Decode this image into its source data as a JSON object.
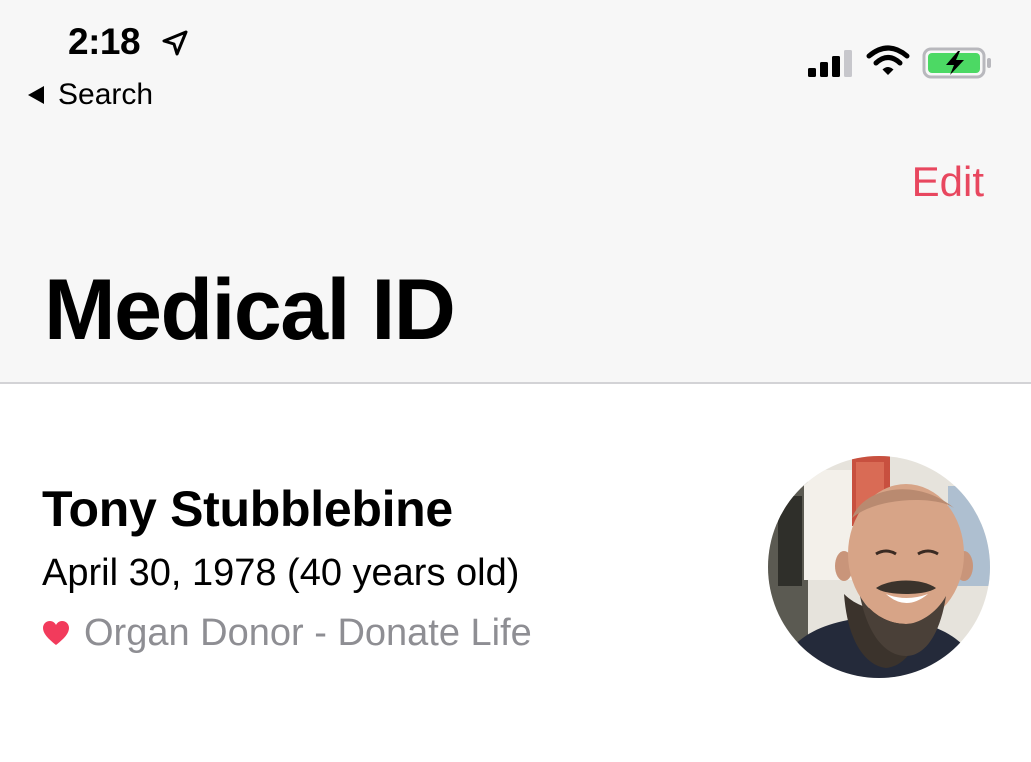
{
  "status_bar": {
    "time": "2:18",
    "back_label": "Search",
    "icons": [
      "location-arrow-icon",
      "cellular-signal-icon",
      "wifi-icon",
      "battery-charging-icon"
    ]
  },
  "nav": {
    "edit_label": "Edit",
    "title": "Medical ID"
  },
  "profile": {
    "name": "Tony Stubblebine",
    "birth": "April 30, 1978 (40 years old)",
    "donor": "Organ Donor - Donate Life"
  },
  "colors": {
    "accent": "#e8475f",
    "battery_fill": "#4cd964",
    "secondary_text": "#8e8e93",
    "header_background": "#f7f7f7"
  }
}
